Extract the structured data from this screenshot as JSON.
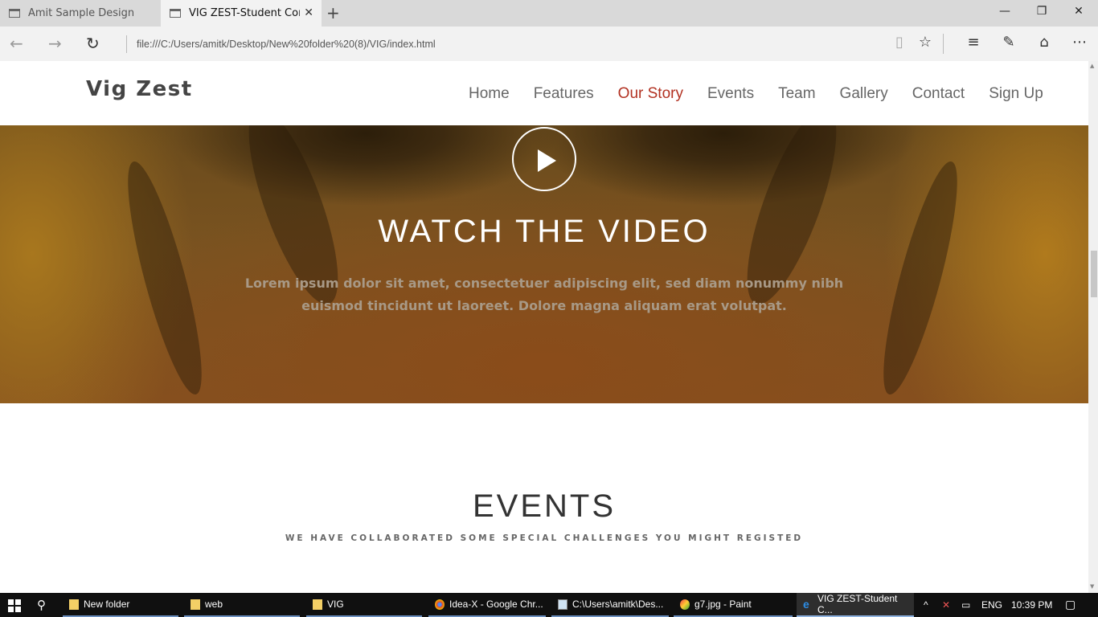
{
  "browser": {
    "tabs": [
      {
        "label": "Amit Sample Design"
      },
      {
        "label": "VIG ZEST-Student Comp",
        "close": "✕"
      }
    ],
    "new_tab": "+",
    "window_controls": {
      "minimize": "—",
      "maximize": "❐",
      "close": "✕"
    },
    "nav": {
      "back": "←",
      "forward": "→",
      "refresh": "↻"
    },
    "url": "file:///C:/Users/amitk/Desktop/New%20folder%20(8)/VIG/index.html",
    "toolbar_icons": [
      "reading-view-icon",
      "favorite-star-icon",
      "hub-icon",
      "web-note-icon",
      "share-icon",
      "more-icon"
    ]
  },
  "site": {
    "brand": "Vig Zest",
    "menu": [
      {
        "label": "Home"
      },
      {
        "label": "Features"
      },
      {
        "label": "Our Story",
        "active": true
      },
      {
        "label": "Events"
      },
      {
        "label": "Team"
      },
      {
        "label": "Gallery"
      },
      {
        "label": "Contact"
      },
      {
        "label": "Sign Up"
      }
    ],
    "active_color": "#b23121",
    "hero": {
      "title": "WATCH THE VIDEO",
      "text": "Lorem ipsum dolor sit amet, consectetuer adipiscing elit, sed diam nonummy nibh euismod tincidunt ut laoreet. Dolore magna aliquam erat volutpat."
    },
    "events": {
      "title": "EVENTS",
      "subtitle": "WE HAVE COLLABORATED SOME SPECIAL CHALLENGES YOU MIGHT REGISTED"
    }
  },
  "taskbar": {
    "items": [
      {
        "label": "New folder",
        "icon": "folder-icon"
      },
      {
        "label": "web",
        "icon": "folder-icon"
      },
      {
        "label": "VIG",
        "icon": "folder-icon"
      },
      {
        "label": "Idea-X - Google Chr...",
        "icon": "chrome-icon"
      },
      {
        "label": "C:\\Users\\amitk\\Des...",
        "icon": "notepad-icon"
      },
      {
        "label": "g7.jpg - Paint",
        "icon": "paint-icon"
      },
      {
        "label": "VIG ZEST-Student C...",
        "icon": "edge-icon",
        "active": true
      }
    ],
    "language": "ENG",
    "time": "10:39 PM"
  }
}
